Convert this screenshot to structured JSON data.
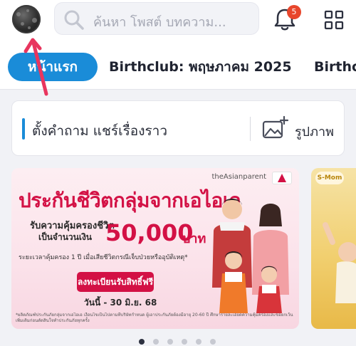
{
  "header": {
    "search_placeholder": "ค้นหา โพสต์ บทความ...",
    "notification_count": "5",
    "icons": [
      "avatar",
      "search-icon",
      "bell-icon",
      "grid-menu-icon"
    ]
  },
  "tabs": [
    {
      "label": "หน้าแรก",
      "active": true
    },
    {
      "label": "Birthclub: พฤษภาคม 2025",
      "active": false
    },
    {
      "label": "Birthclub",
      "active": false
    }
  ],
  "composer": {
    "ask_label": "ตั้งคำถาม แชร์เรื่องราว",
    "photo_label": "รูปภาพ"
  },
  "banner": {
    "brand": "theAsianparent",
    "headline": "ประกันชีวิตกลุ่มจากเอไอเอ",
    "subtitle_line1": "รับความคุ้มครองชีวิต",
    "subtitle_line2": "เป็นจำนวนเงิน",
    "amount": "50,000",
    "amount_unit": "บาท",
    "coverage_note": "ระยะเวลาคุ้มครอง 1 ปี เมื่อเสียชีวิตกรณีเจ็บป่วยหรืออุบัติเหตุ*",
    "cta_label": "ลงทะเบียนรับสิทธิ์ฟรี",
    "date_label": "วันนี้ - 30 มิ.ย. 68",
    "fine_print": "*ผลิตภัณฑ์ประกันภัยกลุ่มจากเอไอเอ เงื่อนไขเป็นไปตามที่บริษัทกำหนด ผู้เอาประกันภัยต้องมีอายุ 20-60 ปี ศึกษารายละเอียดความคุ้มครองและข้อยกเว้นเพิ่มเติมก่อนตัดสินใจทำประกันภัยทุกครั้ง"
  },
  "next_card": {
    "logo_text": "S-Mom"
  },
  "carousel": {
    "page_count": 6,
    "active_index": 0
  },
  "colors": {
    "primary": "#1a8cd8",
    "badge": "#e8462c",
    "aia_red": "#d31145",
    "annotation_arrow": "#e8355e"
  }
}
